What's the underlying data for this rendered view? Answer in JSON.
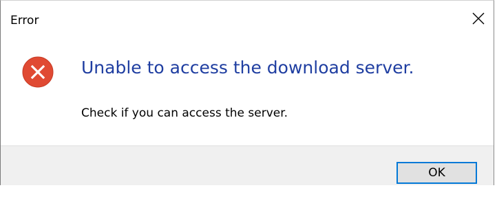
{
  "window": {
    "title": "Error",
    "close_icon": "close-icon"
  },
  "message": {
    "icon": "error-icon",
    "icon_color": "#e04a33",
    "main_instruction": "Unable to access the download server.",
    "content": "Check if you can access the server."
  },
  "buttons": {
    "ok_label": "OK"
  },
  "colors": {
    "main_instruction": "#1f3ea1",
    "focus_border": "#0078d7",
    "footer_background": "#f0f0f0"
  }
}
